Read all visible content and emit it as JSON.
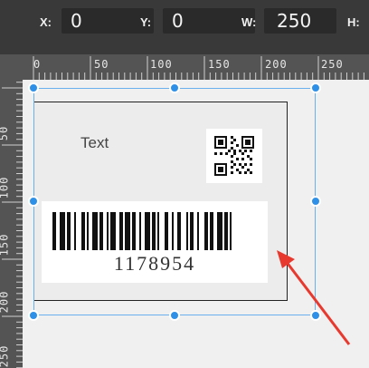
{
  "toolbar": {
    "x_label": "X:",
    "x_value": "0",
    "y_label": "Y:",
    "y_value": "0",
    "w_label": "W:",
    "w_value": "250",
    "h_label": "H:"
  },
  "ruler": {
    "top_labels": [
      "0",
      "50",
      "100",
      "150",
      "200",
      "250"
    ],
    "left_labels": [
      "50",
      "100",
      "150",
      "200",
      "250"
    ]
  },
  "label_content": {
    "text_object": "Text",
    "barcode_number": "1178954"
  },
  "colors": {
    "selection": "#2e90e6",
    "arrow": "#e8392f"
  }
}
